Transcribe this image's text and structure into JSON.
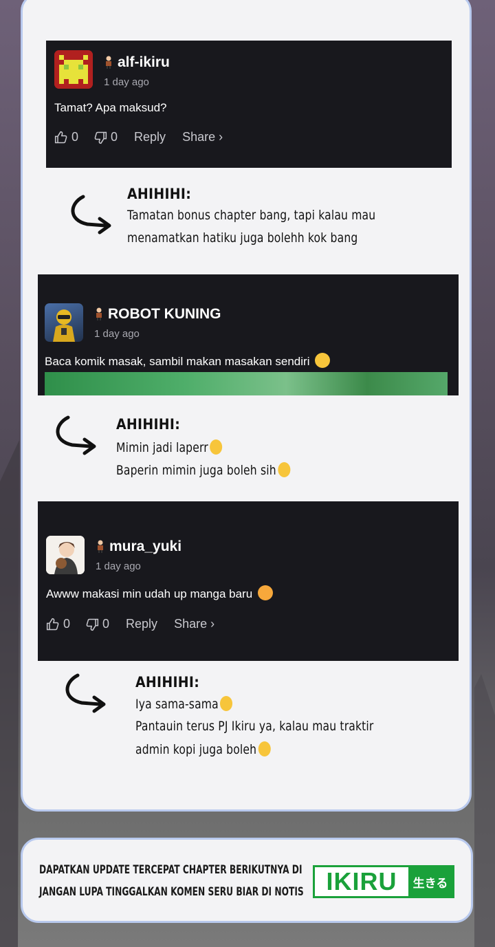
{
  "comments": [
    {
      "username": "alf-ikiru",
      "time": "1 day ago",
      "text": "Tamat? Apa maksud?",
      "likes": "0",
      "dislikes": "0",
      "reply_label": "Reply",
      "share_label": "Share ›",
      "reply": {
        "name": "AHIHIHI:",
        "lines": [
          "Tamatan bonus chapter bang, tapi kalau mau",
          "menamatkan hatiku juga bolehh kok bang"
        ]
      }
    },
    {
      "username": "ROBOT KUNING",
      "time": "1 day ago",
      "text": "Baca komik masak, sambil makan masakan sendiri",
      "reply": {
        "name": "AHIHIHI:",
        "lines": [
          "Mimin jadi laperr",
          "Baperin mimin juga boleh sih"
        ]
      }
    },
    {
      "username": "mura_yuki",
      "time": "1 day ago",
      "text": "Awww makasi min udah up manga baru",
      "likes": "0",
      "dislikes": "0",
      "reply_label": "Reply",
      "share_label": "Share ›",
      "reply": {
        "name": "AHIHIHI:",
        "lines": [
          "Iya sama-sama",
          "Pantauin terus PJ Ikiru ya, kalau mau traktir",
          "admin kopi juga boleh"
        ]
      }
    }
  ],
  "footer": {
    "line1": "DAPATKAN UPDATE TERCEPAT CHAPTER BERIKUTNYA DI",
    "line2": "JANGAN LUPA TINGGALKAN KOMEN SERU BIAR DI NOTIS",
    "logo_text": "IKIRU",
    "logo_jp": "生きる"
  },
  "colors": {
    "card_bg": "#18181d",
    "panel_bg": "#f3f3f5",
    "panel_border": "#b8c9ee",
    "brand_green": "#1aa13a"
  },
  "icons": [
    "rank-badge-icon",
    "thumbs-up-icon",
    "thumbs-down-icon",
    "curved-arrow-icon",
    "emoji-icon"
  ]
}
